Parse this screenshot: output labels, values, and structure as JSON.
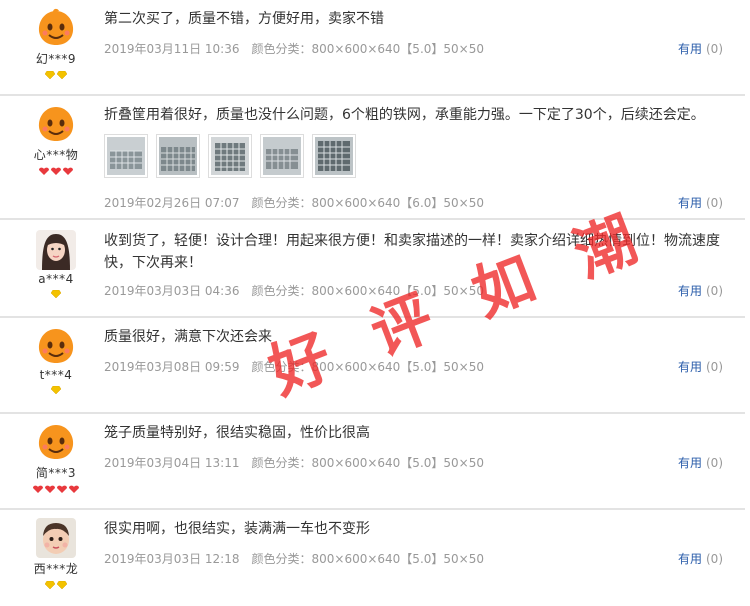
{
  "colors": {
    "helpful_link": "#2a5caa",
    "meta_text": "#999999",
    "divider": "#e3e3e3",
    "watermark": "#ee2828"
  },
  "watermark": "好 评 如 潮",
  "reviews": [
    {
      "user": "幻***9",
      "badge": "gold-diamond",
      "badge_count": 2,
      "text": "第二次买了，质量不错，方便好用，卖家不错",
      "date": "2019年03月11日 10:36",
      "sku": "颜色分类：800×600×640【5.0】50×50",
      "helpful_label": "有用",
      "helpful_count": "(0)"
    },
    {
      "user": "心***物",
      "badge": "red-heart",
      "badge_count": 3,
      "text": "折叠筐用着很好，质量也没什么问题，6个粗的铁网，承重能力强。一下定了30个，后续还会定。",
      "photo_count": 5,
      "date": "2019年02月26日 07:07",
      "sku": "颜色分类：800×600×640【6.0】50×50",
      "helpful_label": "有用",
      "helpful_count": "(0)"
    },
    {
      "user": "a***4",
      "badge": "gold-diamond",
      "badge_count": 1,
      "text": "收到货了，轻便！设计合理！用起来很方便！和卖家描述的一样！卖家介绍详细热情到位！物流速度快，下次再来！",
      "date": "2019年03月03日 04:36",
      "sku": "颜色分类：800×600×640【5.0】50×50",
      "helpful_label": "有用",
      "helpful_count": "(0)"
    },
    {
      "user": "t***4",
      "badge": "gold-diamond",
      "badge_count": 1,
      "text": "质量很好，满意下次还会来",
      "date": "2019年03月08日 09:59",
      "sku": "颜色分类：800×600×640【5.0】50×50",
      "helpful_label": "有用",
      "helpful_count": "(0)"
    },
    {
      "user": "简***3",
      "badge": "red-heart",
      "badge_count": 4,
      "text": "笼子质量特别好，很结实稳固，性价比很高",
      "date": "2019年03月04日 13:11",
      "sku": "颜色分类：800×600×640【5.0】50×50",
      "helpful_label": "有用",
      "helpful_count": "(0)"
    },
    {
      "user": "西***龙",
      "badge": "gold-diamond",
      "badge_count": 2,
      "text": "很实用啊，也很结实，装满满一车也不变形",
      "date": "2019年03月03日 12:18",
      "sku": "颜色分类：800×600×640【5.0】50×50",
      "helpful_label": "有用",
      "helpful_count": "(0)"
    }
  ]
}
